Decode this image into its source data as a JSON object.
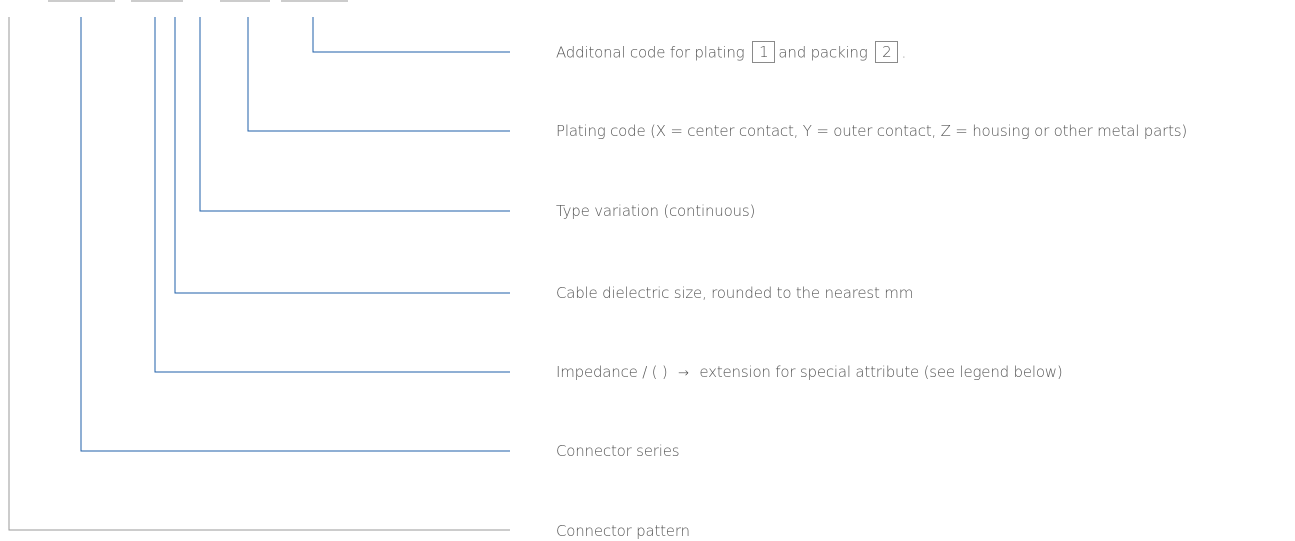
{
  "labels": {
    "additional_code_prefix": "Additonal code for plating",
    "additional_code_box1": "1",
    "additional_code_middle": "and packing",
    "additional_code_box2": "2",
    "additional_code_suffix": ".",
    "plating_code": "Plating code (X = center contact, Y = outer contact, Z = housing or other metal parts)",
    "type_variation": "Type variation (continuous)",
    "cable_dielectric": "Cable dielectric size, rounded to the nearest mm",
    "impedance_prefix": "Impedance / ( )",
    "impedance_arrow": "→",
    "impedance_suffix": "extension for special attribute (see legend below)",
    "connector_series": "Connector series",
    "connector_pattern": "Connector pattern"
  },
  "colors": {
    "blue_line": "#1f5fa8",
    "gray_line": "#9a9a9a",
    "text": "#555555"
  }
}
